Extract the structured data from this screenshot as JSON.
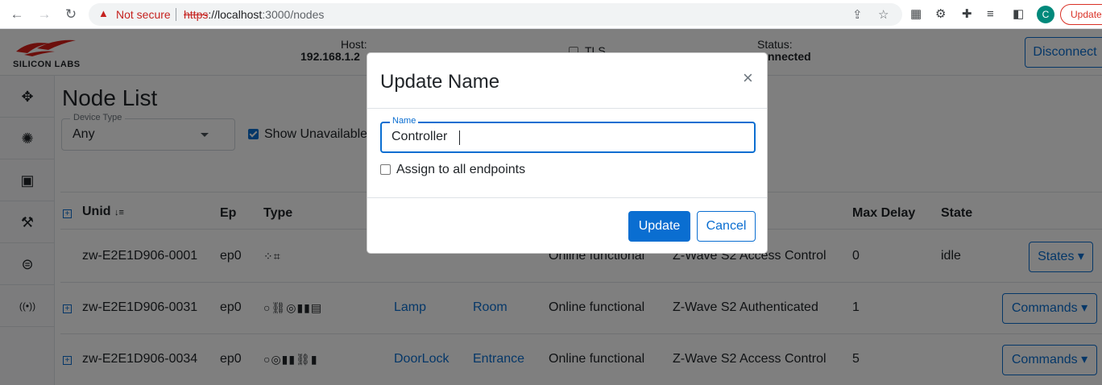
{
  "browser": {
    "not_secure": "Not secure",
    "url_scheme": "https",
    "url_host": "://localhost",
    "url_path": ":3000/nodes",
    "avatar_letter": "C",
    "update_label": "Update"
  },
  "header": {
    "logo_text": "SILICON LABS",
    "host_label": "Host:",
    "host_value": "192.168.1.2",
    "tls_label": "TLS",
    "status_label": "Status:",
    "status_value": "nnected",
    "disconnect_label": "Disconnect"
  },
  "sidebar": {
    "items": [
      {
        "icon": "network-icon"
      },
      {
        "icon": "bug-icon"
      },
      {
        "icon": "chip-icon"
      },
      {
        "icon": "wrench-icon"
      },
      {
        "icon": "toggle-icon"
      },
      {
        "icon": "broadcast-icon"
      }
    ]
  },
  "page": {
    "title": "Node List",
    "device_type_legend": "Device Type",
    "device_type_value": "Any",
    "show_unavailable": "Show Unavailable"
  },
  "table": {
    "headers": {
      "unid": "Unid",
      "ep": "Ep",
      "type": "Type",
      "max_delay": "Max Delay",
      "state": "State"
    },
    "rows": [
      {
        "unid": "zw-E2E1D906-0001",
        "ep": "ep0",
        "type_icons": "⁘⌗",
        "name": "",
        "location": "",
        "status": "Online functional",
        "security": "Z-Wave S2 Access Control",
        "max_delay": "0",
        "state": "idle",
        "action": "States ▾"
      },
      {
        "unid": "zw-E2E1D906-0031",
        "ep": "ep0",
        "type_icons": "○⛓◎▮▮▤",
        "name": "Lamp",
        "location": "Room",
        "status": "Online functional",
        "security": "Z-Wave S2 Authenticated",
        "max_delay": "1",
        "state": "",
        "action": "Commands ▾"
      },
      {
        "unid": "zw-E2E1D906-0034",
        "ep": "ep0",
        "type_icons": "○◎▮▮⛓▮",
        "name": "DoorLock",
        "location": "Entrance",
        "status": "Online functional",
        "security": "Z-Wave S2 Access Control",
        "max_delay": "5",
        "state": "",
        "action": "Commands ▾"
      }
    ]
  },
  "modal": {
    "title": "Update Name",
    "close": "×",
    "field_legend": "Name",
    "field_value": "Controller",
    "assign_label": "Assign to all endpoints",
    "update_button": "Update",
    "cancel_button": "Cancel"
  },
  "colors": {
    "accent": "#0a6ed1",
    "danger": "#c5221f"
  }
}
